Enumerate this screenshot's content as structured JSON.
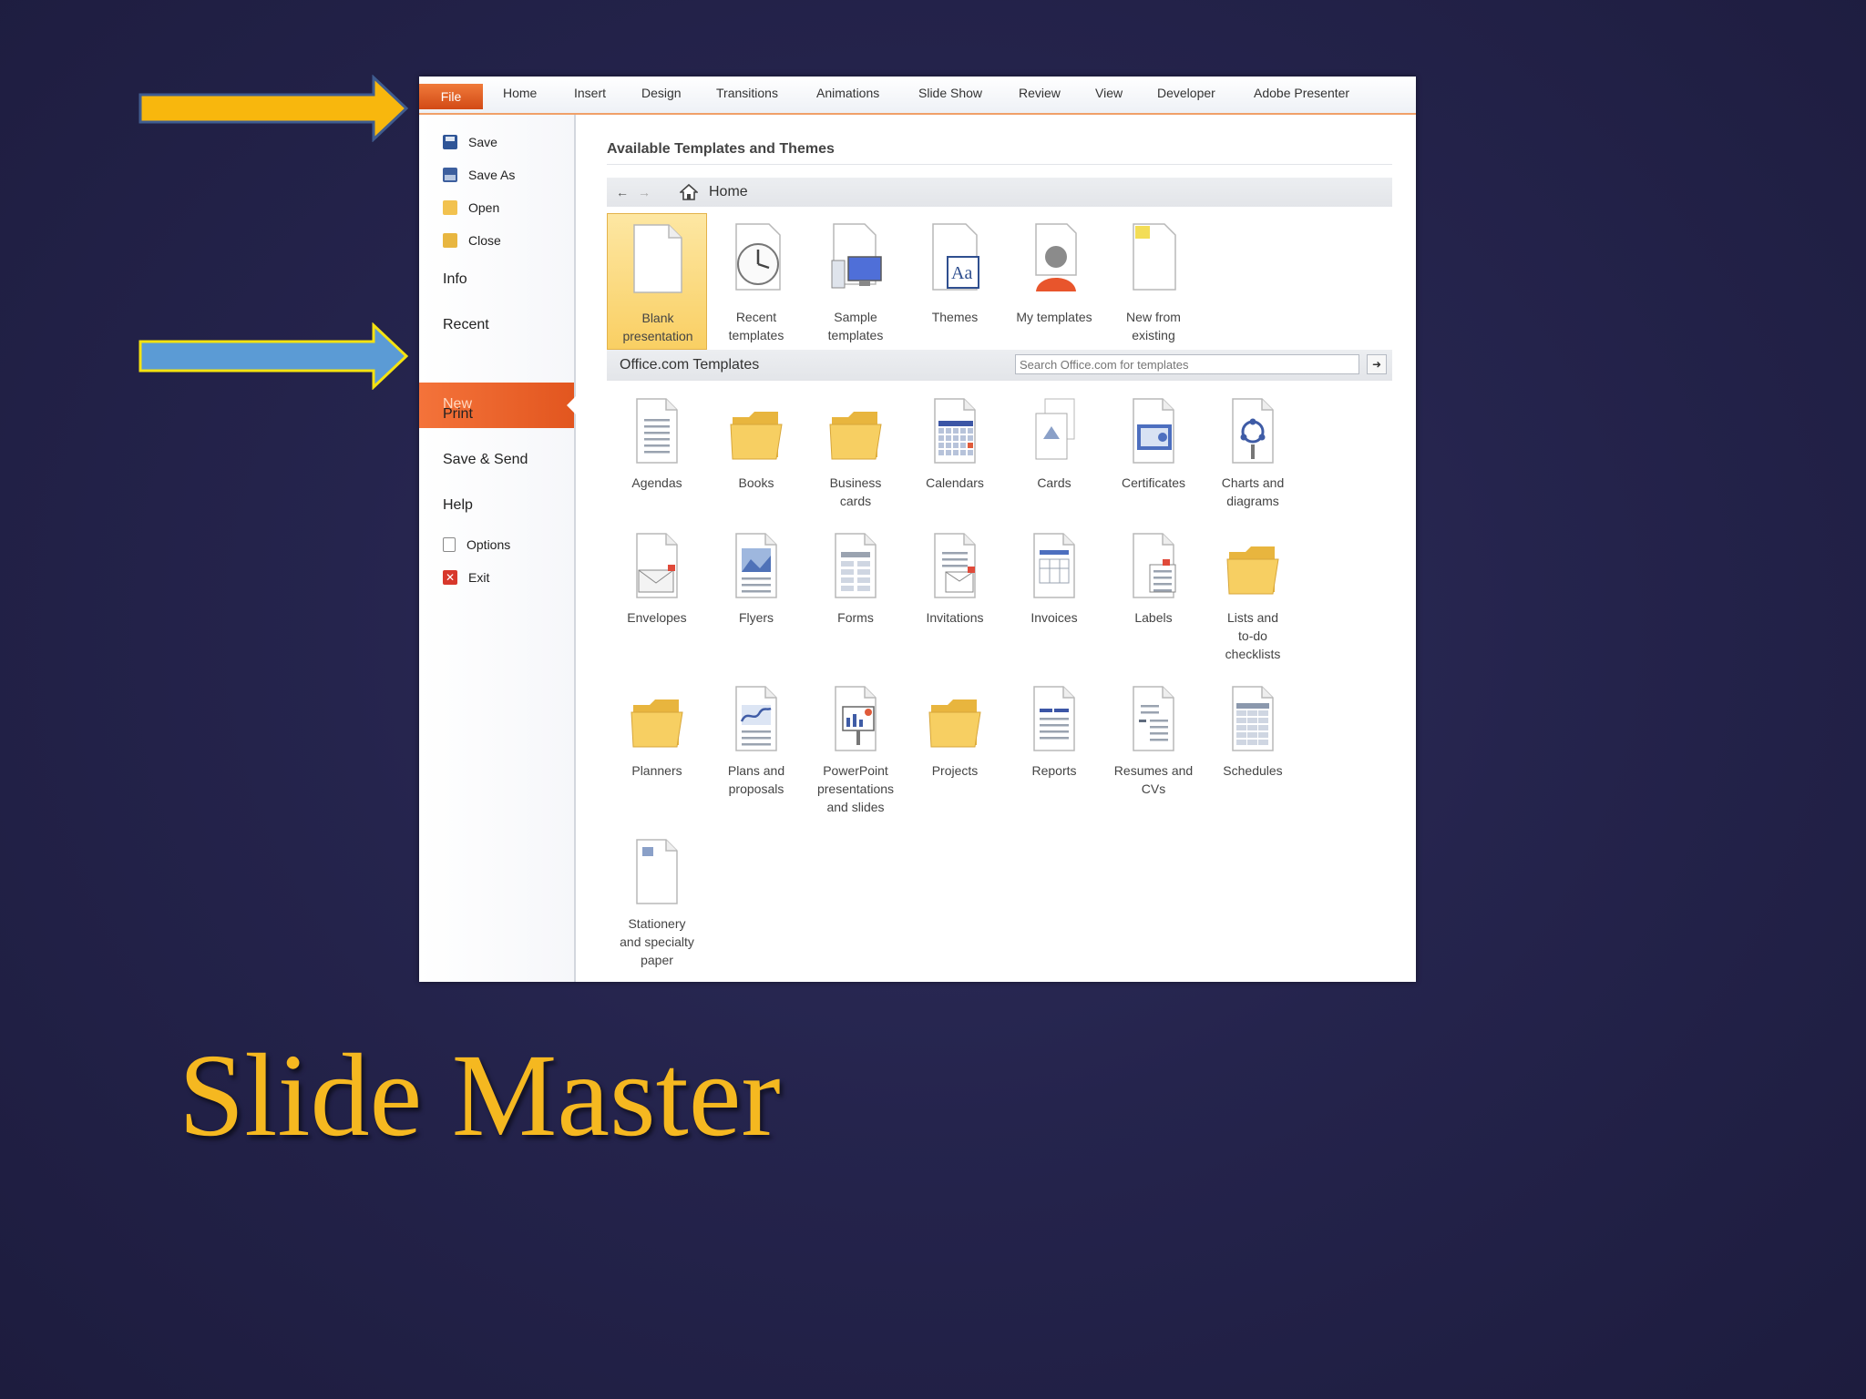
{
  "slide": {
    "title": "Slide Master"
  },
  "colors": {
    "accent_orange": "#e45a20",
    "arrow_yellow": "#f8b70d",
    "arrow_blue": "#5b9bd5",
    "title_gold": "#f5b820",
    "background": "#25244d"
  },
  "ribbon": {
    "tabs": [
      "File",
      "Home",
      "Insert",
      "Design",
      "Transitions",
      "Animations",
      "Slide Show",
      "Review",
      "View",
      "Developer",
      "Adobe Presenter"
    ]
  },
  "backstage": {
    "items": [
      {
        "label": "Save",
        "icon": "save-icon"
      },
      {
        "label": "Save As",
        "icon": "save-as-icon"
      },
      {
        "label": "Open",
        "icon": "open-folder-icon"
      },
      {
        "label": "Close",
        "icon": "close-folder-icon"
      },
      {
        "label": "Info"
      },
      {
        "label": "Recent"
      },
      {
        "label": "New"
      },
      {
        "label": "Print"
      },
      {
        "label": "Save & Send"
      },
      {
        "label": "Help"
      },
      {
        "label": "Options",
        "icon": "options-icon"
      },
      {
        "label": "Exit",
        "icon": "exit-icon"
      }
    ]
  },
  "templates_panel": {
    "title": "Available Templates and Themes",
    "nav": {
      "back_icon": "back-arrow-icon",
      "forward_icon": "forward-arrow-icon",
      "home_icon": "home-icon",
      "location": "Home"
    },
    "top_tiles": [
      {
        "label": "Blank\npresentation",
        "icon": "blank-presentation-icon",
        "selected": true
      },
      {
        "label": "Recent\ntemplates",
        "icon": "recent-templates-icon"
      },
      {
        "label": "Sample\ntemplates",
        "icon": "sample-templates-icon"
      },
      {
        "label": "Themes",
        "icon": "themes-icon"
      },
      {
        "label": "My templates",
        "icon": "my-templates-icon"
      },
      {
        "label": "New from\nexisting",
        "icon": "new-from-existing-icon"
      }
    ],
    "office": {
      "label": "Office.com Templates",
      "search_placeholder": "Search Office.com for templates",
      "search_icon": "arrow-right-icon"
    },
    "categories": [
      {
        "label": "Agendas",
        "icon": "document-icon"
      },
      {
        "label": "Books",
        "icon": "folder-icon"
      },
      {
        "label": "Business\ncards",
        "icon": "folder-icon"
      },
      {
        "label": "Calendars",
        "icon": "calendar-icon"
      },
      {
        "label": "Cards",
        "icon": "cards-icon"
      },
      {
        "label": "Certificates",
        "icon": "certificate-icon"
      },
      {
        "label": "Charts and\ndiagrams",
        "icon": "chart-diagram-icon"
      },
      {
        "label": "Envelopes",
        "icon": "envelope-icon"
      },
      {
        "label": "Flyers",
        "icon": "flyer-icon"
      },
      {
        "label": "Forms",
        "icon": "form-icon"
      },
      {
        "label": "Invitations",
        "icon": "invitation-icon"
      },
      {
        "label": "Invoices",
        "icon": "invoice-icon"
      },
      {
        "label": "Labels",
        "icon": "labels-icon"
      },
      {
        "label": "Lists and\nto-do\nchecklists",
        "icon": "folder-icon"
      },
      {
        "label": "Planners",
        "icon": "folder-icon"
      },
      {
        "label": "Plans and\nproposals",
        "icon": "plans-icon"
      },
      {
        "label": "PowerPoint\npresentations\nand slides",
        "icon": "presentation-icon"
      },
      {
        "label": "Projects",
        "icon": "folder-icon"
      },
      {
        "label": "Reports",
        "icon": "report-icon"
      },
      {
        "label": "Resumes and\nCVs",
        "icon": "resume-icon"
      },
      {
        "label": "Schedules",
        "icon": "schedule-icon"
      },
      {
        "label": "Stationery\nand specialty\npaper",
        "icon": "stationery-icon"
      }
    ]
  }
}
